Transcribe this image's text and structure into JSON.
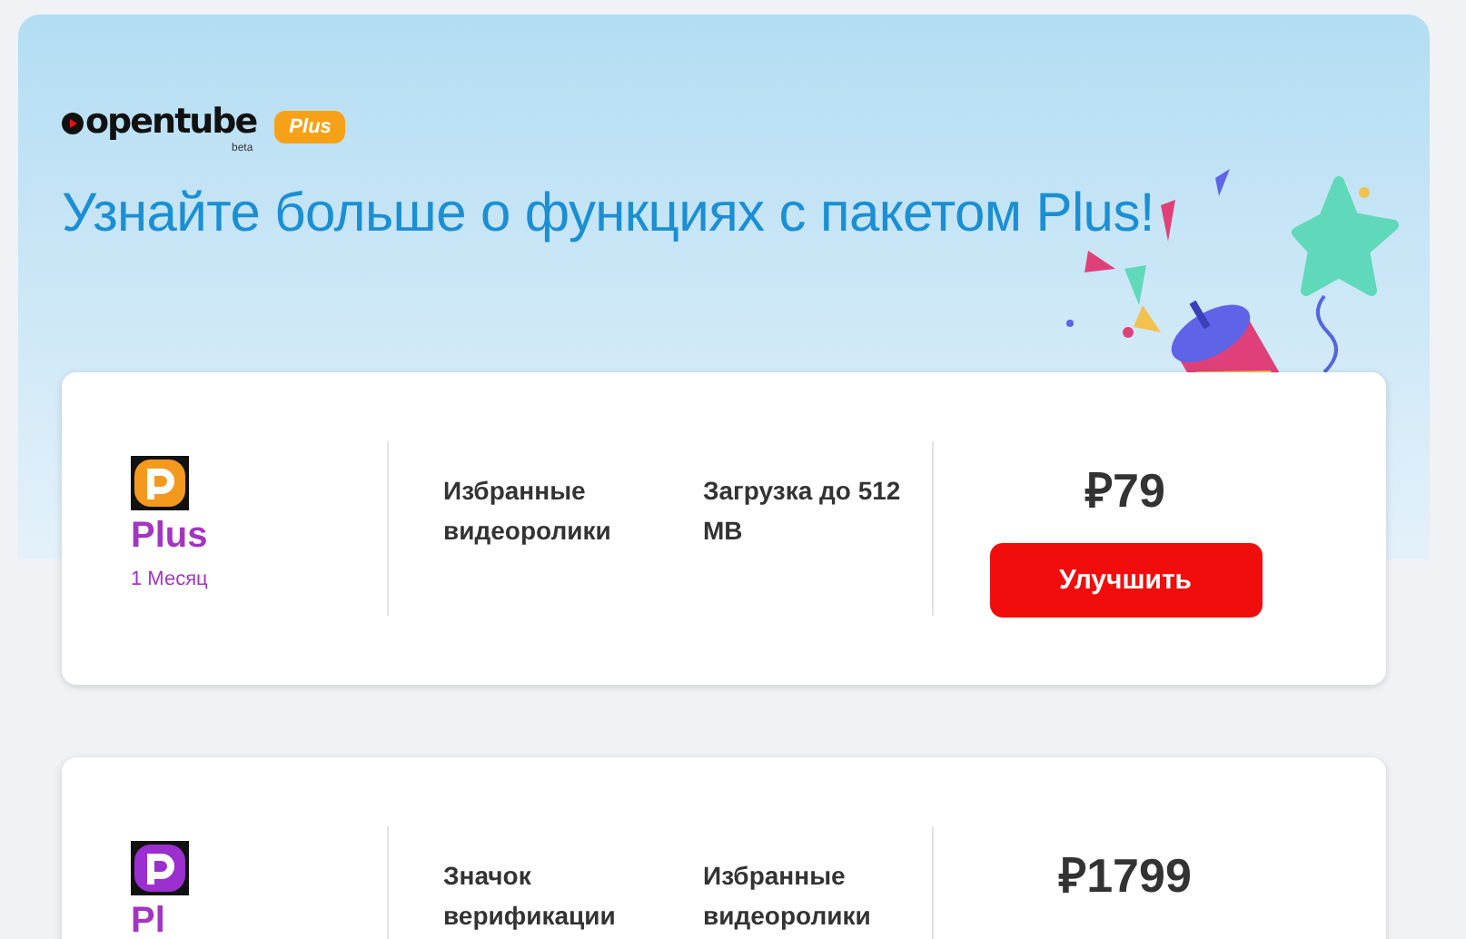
{
  "logo": {
    "name": "opentube",
    "tag": "beta"
  },
  "plan_badge": "Plus",
  "headline": "Узнайте больше о функциях с пакетом Plus!",
  "plans": [
    {
      "kind": "orange",
      "name": "Plus",
      "period": "1 Месяц",
      "features": [
        "Избранные видеоролики",
        "Загрузка до 512 MB"
      ],
      "price": "₽79",
      "button": "Улучшить"
    },
    {
      "kind": "purple",
      "name": "Pl",
      "features": [
        "Значок верификации",
        "Избранные видеоролики"
      ],
      "price": "₽1799"
    }
  ]
}
